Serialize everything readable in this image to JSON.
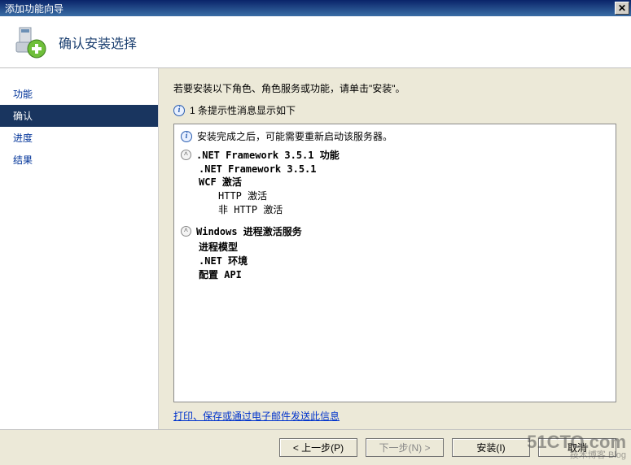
{
  "window": {
    "title": "添加功能向导"
  },
  "header": {
    "title": "确认安装选择"
  },
  "sidebar": {
    "items": [
      {
        "label": "功能"
      },
      {
        "label": "确认"
      },
      {
        "label": "进度"
      },
      {
        "label": "结果"
      }
    ]
  },
  "content": {
    "instruction": "若要安装以下角色、角色服务或功能，请单击\"安装\"。",
    "info_count": "1 条提示性消息显示如下",
    "restart_warning": "安装完成之后，可能需要重新启动该服务器。",
    "sections": [
      {
        "title": ".NET Framework 3.5.1 功能",
        "items": [
          {
            "level": 1,
            "text": ".NET Framework 3.5.1"
          },
          {
            "level": 2,
            "text": "WCF 激活"
          },
          {
            "level": 3,
            "text": "HTTP 激活"
          },
          {
            "level": 3,
            "text": "非 HTTP 激活"
          }
        ]
      },
      {
        "title": "Windows 进程激活服务",
        "items": [
          {
            "level": 1,
            "text": "进程模型"
          },
          {
            "level": 1,
            "text": ".NET 环境"
          },
          {
            "level": 1,
            "text": "配置 API"
          }
        ]
      }
    ],
    "link": "打印、保存或通过电子邮件发送此信息"
  },
  "footer": {
    "prev": "< 上一步(P)",
    "next": "下一步(N) >",
    "install": "安装(I)",
    "cancel": "取消"
  },
  "watermark": {
    "main": "51CTO.com",
    "sub": "技术博客  Blog"
  }
}
